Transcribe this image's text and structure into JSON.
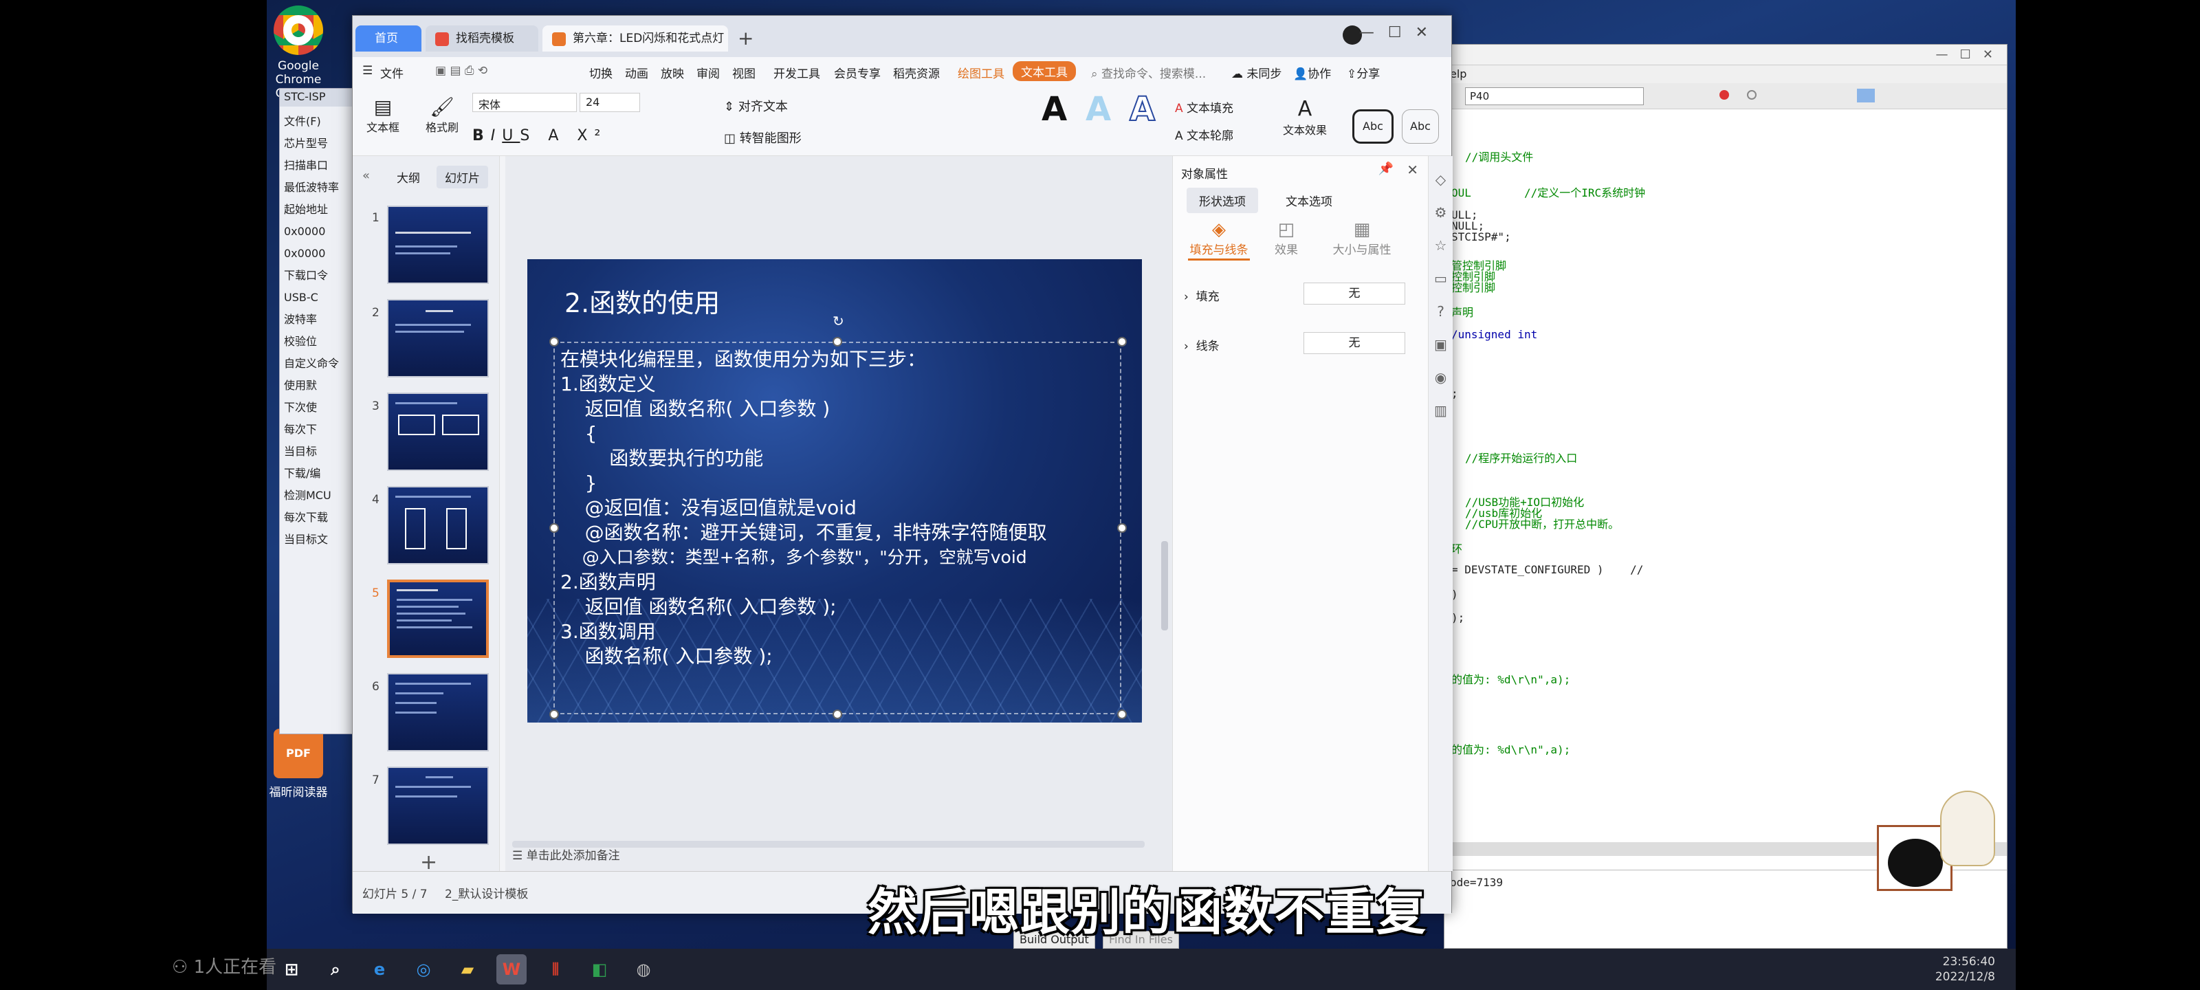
{
  "desktop": {
    "icons": [
      {
        "name": "Google Chrome",
        "line2": "Chrome"
      },
      {
        "name": "福昕阅读器"
      }
    ],
    "viewers": "1人正在看"
  },
  "taskbar": {
    "time": "23:56:40",
    "date": "2022/12/8"
  },
  "stc": {
    "title": "STC-ISP",
    "lines": [
      "文件(F)",
      "芯片型号",
      "扫描串口",
      "最低波特率",
      "起始地址",
      "0x0000",
      "0x0000",
      "下载口令",
      "USB-C",
      "波特率",
      "校验位",
      "自定义命令",
      "使用默",
      "下次使",
      "每次下",
      "当目标",
      "下载/编",
      "检测MCU",
      "每次下载",
      "当目标文"
    ]
  },
  "ide": {
    "toolbar_field": "P40",
    "menu_fragment": "elp",
    "code": [
      "//调用头文件",
      "OUL        //定义一个IRC系统时钟",
      "ULL;",
      "NULL;",
      "STCISP#\";",
      "管控制引脚",
      "控制引脚",
      "控制引脚",
      "声明",
      "/unsigned int",
      ";",
      "//程序开始运行的入口",
      "//USB功能+IO口初始化",
      "//usb库初始化",
      "//CPU开放中断，打开总中断。",
      "环",
      "= DEVSTATE_CONFIGURED )    //",
      ")",
      ");",
      "的值为: %d\\r\\n\",a);",
      "的值为: %d\\r\\n\",a);"
    ],
    "output_text": "ode=7139",
    "bottom_tabs": [
      "Build Output",
      "Find In Files"
    ]
  },
  "wps": {
    "tabs": [
      "首页",
      "找稻壳模板",
      "第六章：LED闪烁和花式点灯"
    ],
    "menu": {
      "file": "文件",
      "items": [
        "切换",
        "动画",
        "放映",
        "审阅",
        "视图",
        "开发工具",
        "会员专享",
        "稻壳资源"
      ],
      "drawing_tool": "绘图工具",
      "text_tool": "文本工具",
      "search": "查找命令、搜索模...",
      "sync": "未同步",
      "collab": "协作",
      "share": "分享"
    },
    "ribbon": {
      "textbox": "文本框",
      "format_painter": "格式刷",
      "font": "宋体",
      "size": "24",
      "align_text": "对齐文本",
      "smart_shape": "转智能图形",
      "text_fill": "文本填充",
      "text_outline": "文本轮廓",
      "text_effect": "文本效果",
      "abc": "Abc"
    },
    "outline_tabs": [
      "大纲",
      "幻灯片"
    ],
    "slides_count": 7,
    "current_slide": 5,
    "slide": {
      "title": "2.函数的使用",
      "lines": [
        "在模块化编程里，函数使用分为如下三步：",
        "1.函数定义",
        "    返回值 函数名称( 入口参数 )",
        "    {",
        "        函数要执行的功能",
        "    }",
        "    @返回值：没有返回值就是void",
        "    @函数名称：避开关键词，不重复，非特殊字符随便取",
        "    @入口参数：类型+名称，多个参数\"，\"分开，空就写void",
        "2.函数声明",
        "    返回值 函数名称( 入口参数 );",
        "3.函数调用",
        "    函数名称( 入口参数 );"
      ]
    },
    "props": {
      "title": "对象属性",
      "tabs": [
        "形状选项",
        "文本选项"
      ],
      "subtabs": [
        "填充与线条",
        "效果",
        "大小与属性"
      ],
      "fill_label": "填充",
      "fill_value": "无",
      "line_label": "线条",
      "line_value": "无"
    },
    "status": {
      "slide_pos": "幻灯片 5 / 7",
      "template": "2_默认设计模板",
      "notes_hint": "单击此处添加备注"
    }
  },
  "subtitle": "然后嗯跟别的函数不重复"
}
